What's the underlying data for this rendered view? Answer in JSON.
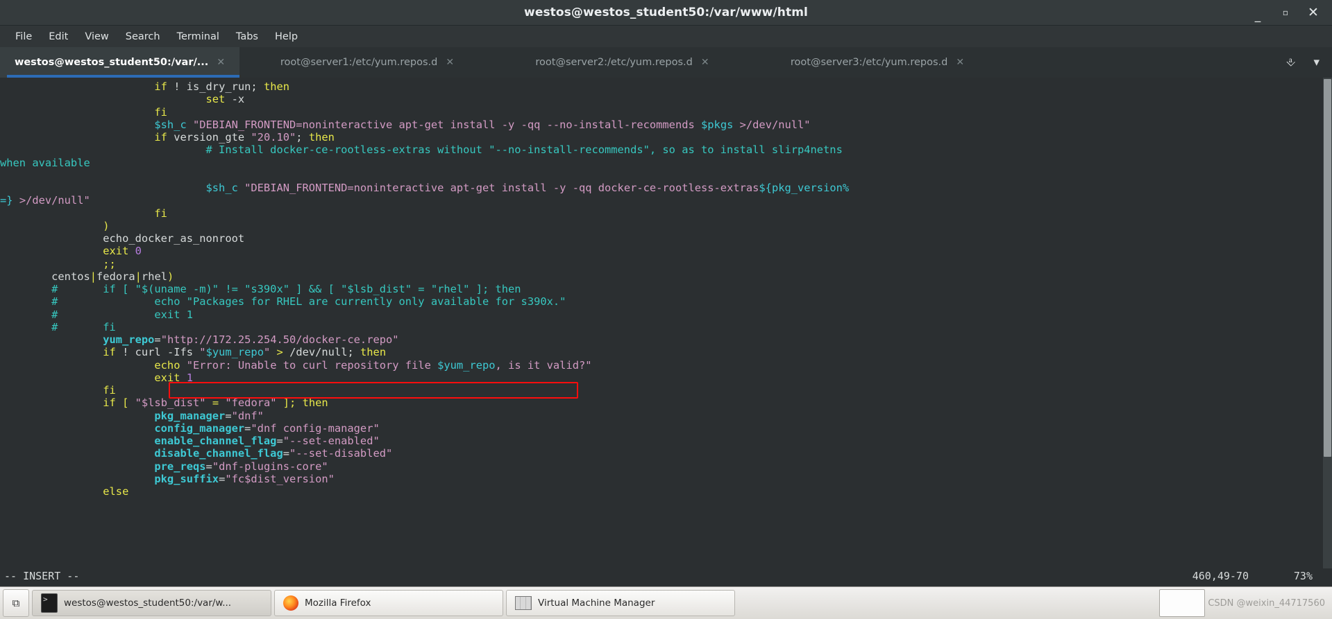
{
  "window": {
    "title": "westos@westos_student50:/var/www/html",
    "buttons": {
      "minimize": "_",
      "maximize": "▫",
      "close": "✕"
    }
  },
  "menubar": {
    "items": [
      "File",
      "Edit",
      "View",
      "Search",
      "Terminal",
      "Tabs",
      "Help"
    ]
  },
  "tabs": {
    "items": [
      {
        "label": "westos@westos_student50:/var/...",
        "close": "✕",
        "active": true
      },
      {
        "label": "root@server1:/etc/yum.repos.d",
        "close": "✕",
        "active": false
      },
      {
        "label": "root@server2:/etc/yum.repos.d",
        "close": "✕",
        "active": false
      },
      {
        "label": "root@server3:/etc/yum.repos.d",
        "close": "✕",
        "active": false
      }
    ],
    "new_tab_icon": "⎀",
    "menu_icon": "▾"
  },
  "terminal": {
    "lines": [
      [
        {
          "t": "                        ",
          "c": "c-white"
        },
        {
          "t": "if",
          "c": "c-kw"
        },
        {
          "t": " ! is_dry_run; ",
          "c": "c-id"
        },
        {
          "t": "then",
          "c": "c-kw"
        }
      ],
      [
        {
          "t": "                                ",
          "c": "c-white"
        },
        {
          "t": "set",
          "c": "c-kw"
        },
        {
          "t": " -x",
          "c": "c-id"
        }
      ],
      [
        {
          "t": "                        ",
          "c": "c-white"
        },
        {
          "t": "fi",
          "c": "c-kw"
        }
      ],
      [
        {
          "t": "                        ",
          "c": "c-white"
        },
        {
          "t": "$sh_c",
          "c": "c-var"
        },
        {
          "t": " \"DEBIAN_FRONTEND=noninteractive apt-get install -y -qq --no-install-recommends ",
          "c": "c-str"
        },
        {
          "t": "$pkgs",
          "c": "c-var"
        },
        {
          "t": " >/dev/null\"",
          "c": "c-str"
        }
      ],
      [
        {
          "t": "                        ",
          "c": "c-white"
        },
        {
          "t": "if",
          "c": "c-kw"
        },
        {
          "t": " version_gte ",
          "c": "c-id"
        },
        {
          "t": "\"20.10\"",
          "c": "c-str"
        },
        {
          "t": "; ",
          "c": "c-id"
        },
        {
          "t": "then",
          "c": "c-kw"
        }
      ],
      [
        {
          "t": "                                ",
          "c": "c-white"
        },
        {
          "t": "# Install docker-ce-rootless-extras without \"--no-install-recommends\", so as to install slirp4netns",
          "c": "c-cmt"
        }
      ],
      [
        {
          "t": "when available",
          "c": "c-cmt"
        }
      ],
      [
        {
          "t": "",
          "c": "c-white"
        }
      ],
      [
        {
          "t": "                                ",
          "c": "c-white"
        },
        {
          "t": "$sh_c",
          "c": "c-var"
        },
        {
          "t": " \"DEBIAN_FRONTEND=noninteractive apt-get install -y -qq docker-ce-rootless-extras",
          "c": "c-str"
        },
        {
          "t": "${pkg_version%",
          "c": "c-var"
        }
      ],
      [
        {
          "t": "=}",
          "c": "c-var"
        },
        {
          "t": " >/dev/null\"",
          "c": "c-str"
        }
      ],
      [
        {
          "t": "                        ",
          "c": "c-white"
        },
        {
          "t": "fi",
          "c": "c-kw"
        }
      ],
      [
        {
          "t": "                ",
          "c": "c-white"
        },
        {
          "t": ")",
          "c": "c-kw"
        }
      ],
      [
        {
          "t": "                ",
          "c": "c-white"
        },
        {
          "t": "echo_docker_as_nonroot",
          "c": "c-id"
        }
      ],
      [
        {
          "t": "                ",
          "c": "c-white"
        },
        {
          "t": "exit",
          "c": "c-kw"
        },
        {
          "t": " ",
          "c": "c-white"
        },
        {
          "t": "0",
          "c": "c-num"
        }
      ],
      [
        {
          "t": "                ",
          "c": "c-white"
        },
        {
          "t": ";;",
          "c": "c-kw"
        }
      ],
      [
        {
          "t": "        ",
          "c": "c-white"
        },
        {
          "t": "centos",
          "c": "c-id"
        },
        {
          "t": "|",
          "c": "c-kw"
        },
        {
          "t": "fedora",
          "c": "c-id"
        },
        {
          "t": "|",
          "c": "c-kw"
        },
        {
          "t": "rhel",
          "c": "c-id"
        },
        {
          "t": ")",
          "c": "c-kw"
        }
      ],
      [
        {
          "t": "        ",
          "c": "c-white"
        },
        {
          "t": "#       if [ \"$(uname -m)\" != \"s390x\" ] && [ \"$lsb_dist\" = \"rhel\" ]; then",
          "c": "c-cmt"
        }
      ],
      [
        {
          "t": "        ",
          "c": "c-white"
        },
        {
          "t": "#               echo \"Packages for RHEL are currently only available for s390x.\"",
          "c": "c-cmt"
        }
      ],
      [
        {
          "t": "        ",
          "c": "c-white"
        },
        {
          "t": "#               exit 1",
          "c": "c-cmt"
        }
      ],
      [
        {
          "t": "        ",
          "c": "c-white"
        },
        {
          "t": "#       fi",
          "c": "c-cmt"
        }
      ],
      [
        {
          "t": "                ",
          "c": "c-white"
        },
        {
          "t": "yum_repo",
          "c": "c-varb"
        },
        {
          "t": "=",
          "c": "c-white"
        },
        {
          "t": "\"http://172.25.254.50/docker-ce.repo\"",
          "c": "c-str"
        }
      ],
      [
        {
          "t": "                ",
          "c": "c-white"
        },
        {
          "t": "if",
          "c": "c-kw"
        },
        {
          "t": " ! curl -Ifs ",
          "c": "c-id"
        },
        {
          "t": "\"",
          "c": "c-str"
        },
        {
          "t": "$yum_repo",
          "c": "c-var"
        },
        {
          "t": "\"",
          "c": "c-str"
        },
        {
          "t": " ",
          "c": "c-white"
        },
        {
          "t": ">",
          "c": "c-kw"
        },
        {
          "t": " /dev/null; ",
          "c": "c-id"
        },
        {
          "t": "then",
          "c": "c-kw"
        }
      ],
      [
        {
          "t": "                        ",
          "c": "c-white"
        },
        {
          "t": "echo",
          "c": "c-kw"
        },
        {
          "t": " \"Error: Unable to curl repository file ",
          "c": "c-str"
        },
        {
          "t": "$yum_repo",
          "c": "c-var"
        },
        {
          "t": ", is it valid?\"",
          "c": "c-str"
        }
      ],
      [
        {
          "t": "                        ",
          "c": "c-white"
        },
        {
          "t": "exit",
          "c": "c-kw"
        },
        {
          "t": " ",
          "c": "c-white"
        },
        {
          "t": "1",
          "c": "c-num"
        }
      ],
      [
        {
          "t": "                ",
          "c": "c-white"
        },
        {
          "t": "fi",
          "c": "c-kw"
        }
      ],
      [
        {
          "t": "                ",
          "c": "c-white"
        },
        {
          "t": "if",
          "c": "c-kw"
        },
        {
          "t": " [ ",
          "c": "c-kw"
        },
        {
          "t": "\"$lsb_dist\"",
          "c": "c-str"
        },
        {
          "t": " = ",
          "c": "c-kw"
        },
        {
          "t": "\"fedora\"",
          "c": "c-str"
        },
        {
          "t": " ]; ",
          "c": "c-kw"
        },
        {
          "t": "then",
          "c": "c-kw"
        }
      ],
      [
        {
          "t": "                        ",
          "c": "c-white"
        },
        {
          "t": "pkg_manager",
          "c": "c-varb"
        },
        {
          "t": "=",
          "c": "c-white"
        },
        {
          "t": "\"dnf\"",
          "c": "c-str"
        }
      ],
      [
        {
          "t": "                        ",
          "c": "c-white"
        },
        {
          "t": "config_manager",
          "c": "c-varb"
        },
        {
          "t": "=",
          "c": "c-white"
        },
        {
          "t": "\"dnf config-manager\"",
          "c": "c-str"
        }
      ],
      [
        {
          "t": "                        ",
          "c": "c-white"
        },
        {
          "t": "enable_channel_flag",
          "c": "c-varb"
        },
        {
          "t": "=",
          "c": "c-white"
        },
        {
          "t": "\"--set-enabled\"",
          "c": "c-str"
        }
      ],
      [
        {
          "t": "                        ",
          "c": "c-white"
        },
        {
          "t": "disable_channel_flag",
          "c": "c-varb"
        },
        {
          "t": "=",
          "c": "c-white"
        },
        {
          "t": "\"--set-disabled\"",
          "c": "c-str"
        }
      ],
      [
        {
          "t": "                        ",
          "c": "c-white"
        },
        {
          "t": "pre_reqs",
          "c": "c-varb"
        },
        {
          "t": "=",
          "c": "c-white"
        },
        {
          "t": "\"dnf-plugins-core\"",
          "c": "c-str"
        }
      ],
      [
        {
          "t": "                        ",
          "c": "c-white"
        },
        {
          "t": "pkg_suffix",
          "c": "c-varb"
        },
        {
          "t": "=",
          "c": "c-white"
        },
        {
          "t": "\"fc$dist_version\"",
          "c": "c-str"
        }
      ],
      [
        {
          "t": "                ",
          "c": "c-white"
        },
        {
          "t": "else",
          "c": "c-kw"
        }
      ]
    ],
    "highlight_note": "red box around yum_repo assignment"
  },
  "statusline": {
    "mode": "-- INSERT --",
    "position": "460,49-70",
    "percent": "73%"
  },
  "taskbar": {
    "launcher_icon": "show-desktop-icon",
    "items": [
      {
        "label": "westos@westos_student50:/var/w...",
        "icon": "terminal-icon",
        "active": true
      },
      {
        "label": "Mozilla Firefox",
        "icon": "firefox-icon",
        "active": false
      },
      {
        "label": "Virtual Machine Manager",
        "icon": "vmm-icon",
        "active": false
      }
    ],
    "watermark": "CSDN @weixin_44717560"
  }
}
